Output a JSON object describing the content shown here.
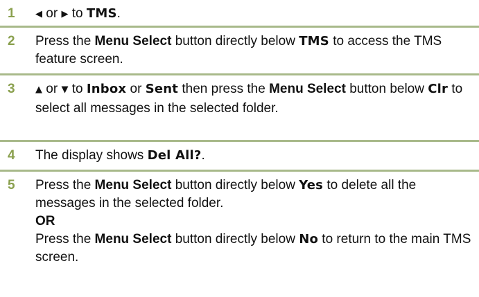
{
  "steps": [
    {
      "number": "1",
      "arrow_left": "◀",
      "or1": " or ",
      "arrow_right": "▶",
      "to": " to ",
      "tms": "TMS",
      "end": "."
    },
    {
      "number": "2",
      "t1": "Press the ",
      "menu_select": "Menu Select",
      "t2": " button directly below ",
      "tms": "TMS",
      "t3": " to access the TMS feature screen."
    },
    {
      "number": "3",
      "arrow_up": "▲",
      "or1": " or ",
      "arrow_down": "▼",
      "to": " to ",
      "inbox": "Inbox",
      "or2": " or ",
      "sent": "Sent",
      "t1": " then press the ",
      "menu_select": "Menu Select",
      "t2": " button below ",
      "clr": "Clr",
      "t3": " to select all messages in the selected folder."
    },
    {
      "number": "4",
      "t1": "The display shows ",
      "del_all": "Del All?",
      "end": "."
    },
    {
      "number": "5",
      "t1": "Press the ",
      "menu_select": "Menu Select",
      "t2": " button directly below ",
      "yes": "Yes",
      "t3": " to delete all the messages in the selected folder.",
      "or_label": "OR",
      "t4": "Press the ",
      "menu_select2": "Menu Select",
      "t5": " button directly below ",
      "no": "No",
      "t6": " to return to the main TMS screen."
    }
  ]
}
